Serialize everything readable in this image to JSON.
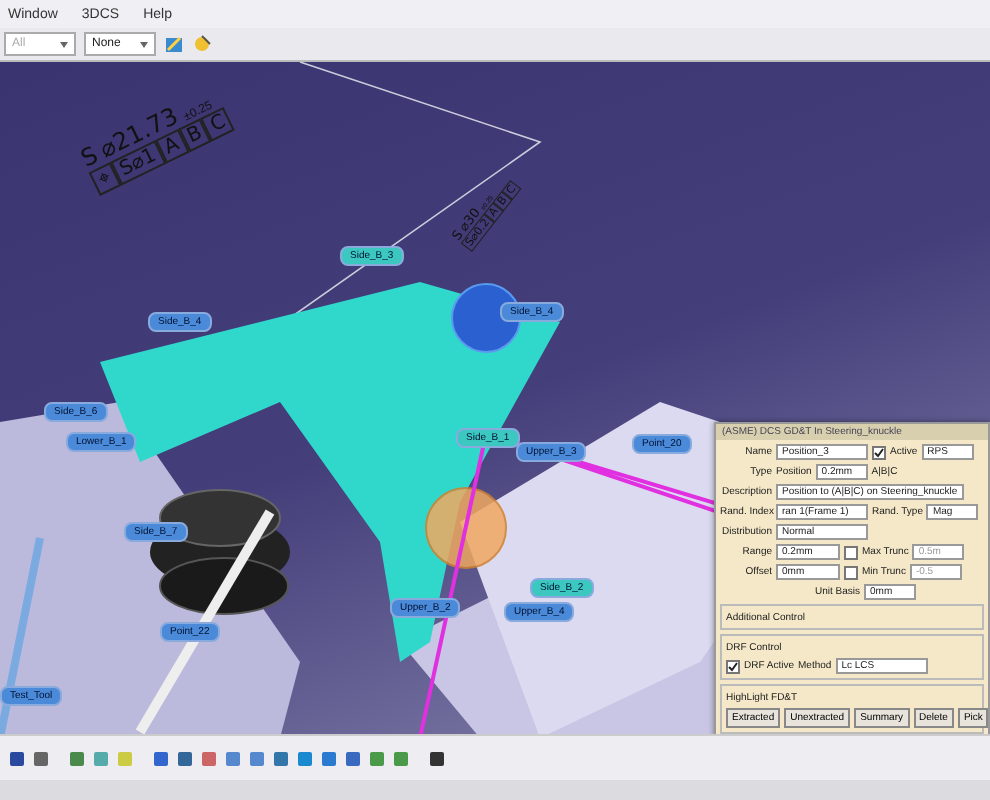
{
  "menu": [
    "Window",
    "3DCS",
    "Help"
  ],
  "toolbar": {
    "dropdowns": [
      {
        "value": "All",
        "disabled": true
      },
      {
        "value": "None",
        "disabled": false
      }
    ]
  },
  "viewport": {
    "gdt_frames": [
      {
        "symbol": "S",
        "size": "⌀21.73",
        "tolerance": "±0.25",
        "cells": [
          "⌖",
          "S⌀1",
          "A",
          "B",
          "C"
        ]
      },
      {
        "symbol": "S",
        "size": "⌀30",
        "tolerance": "±0.25",
        "cells": [
          "S⌀0.2",
          "A",
          "B",
          "C"
        ]
      }
    ],
    "labels": [
      {
        "text": "Side_B_3",
        "highlighted": true
      },
      {
        "text": "Side_B_4",
        "highlighted": false
      },
      {
        "text": "Side_B_4",
        "highlighted": false
      },
      {
        "text": "Side_B_1",
        "highlighted": true
      },
      {
        "text": "Upper_B_3",
        "highlighted": false
      },
      {
        "text": "Point_20",
        "highlighted": false
      },
      {
        "text": "Side_B_6",
        "highlighted": false
      },
      {
        "text": "Side_B_7",
        "highlighted": false
      },
      {
        "text": "Lower_B_1",
        "highlighted": false
      },
      {
        "text": "Upper_B_2",
        "highlighted": false
      },
      {
        "text": "Side_B_2",
        "highlighted": true
      },
      {
        "text": "Upper_B_4",
        "highlighted": false
      },
      {
        "text": "Point_22",
        "highlighted": false
      },
      {
        "text": "Test_Tool",
        "highlighted": false
      }
    ]
  },
  "dialog": {
    "title": "(ASME) DCS GD&T In Steering_knuckle",
    "name": {
      "label": "Name",
      "value": "Position_3"
    },
    "active": {
      "label": "Active",
      "checked": true
    },
    "rps": "RPS",
    "type": {
      "label": "Type",
      "value": "Position",
      "amount": "0.2mm",
      "datums": "A|B|C"
    },
    "description": {
      "label": "Description",
      "value": "Position to (A|B|C) on Steering_knuckle"
    },
    "rand_index": {
      "label": "Rand. Index",
      "value": "ran 1(Frame 1)"
    },
    "rand_type": {
      "label": "Rand. Type",
      "value": "Mag"
    },
    "distribution": {
      "label": "Distribution",
      "value": "Normal"
    },
    "range": {
      "label": "Range",
      "value": "0.2mm"
    },
    "offset": {
      "label": "Offset",
      "value": "0mm"
    },
    "max_trunc": {
      "label": "Max Trunc",
      "checked": false,
      "disabled": true,
      "value": "0.5m"
    },
    "min_trunc": {
      "label": "Min Trunc",
      "checked": false,
      "disabled": true,
      "value": "-0.5"
    },
    "unit_basis": {
      "label": "Unit Basis",
      "value": "0mm"
    },
    "additional_control": "Additional Control",
    "drf_control": {
      "title": "DRF Control",
      "active_label": "DRF Active",
      "active": true,
      "method_label": "Method",
      "method": "Lc LCS"
    },
    "highlight": {
      "title": "HighLight FD&T",
      "buttons": [
        "Extracted",
        "Unextracted",
        "Summary",
        "Delete",
        "Pick"
      ]
    }
  }
}
